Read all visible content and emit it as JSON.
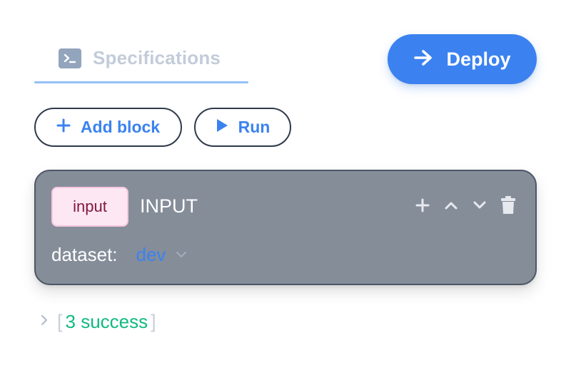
{
  "tab": {
    "label": "Specifications",
    "icon": "terminal-icon"
  },
  "deploy": {
    "label": "Deploy",
    "icon": "arrow-right-icon"
  },
  "toolbar": {
    "add_block_label": "Add block",
    "run_label": "Run"
  },
  "block": {
    "type": "input",
    "name": "INPUT",
    "param_label": "dataset:",
    "param_value": "dev",
    "actions": [
      "plus-icon",
      "chevron-up-icon",
      "chevron-down-icon",
      "trash-icon"
    ]
  },
  "status": {
    "open_bracket": "[",
    "text": "3 success",
    "close_bracket": "]"
  },
  "colors": {
    "accent": "#3b82f0",
    "block_bg": "#858d99",
    "badge_bg": "#fce7f3",
    "badge_text": "#831843",
    "success": "#10b981"
  }
}
